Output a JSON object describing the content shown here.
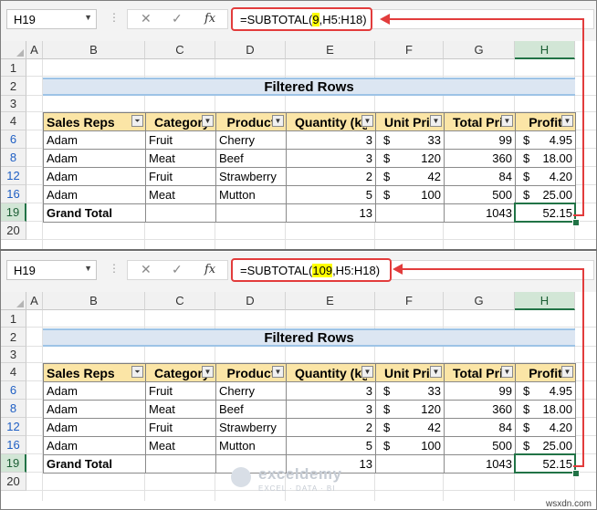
{
  "panels": [
    {
      "name_box": "H19",
      "formula_prefix": "=SUBTOTAL(",
      "formula_highlight": "9",
      "formula_suffix": ",H5:H18)"
    },
    {
      "name_box": "H19",
      "formula_prefix": "=SUBTOTAL(",
      "formula_highlight": "109",
      "formula_suffix": ",H5:H18)"
    }
  ],
  "formula_buttons": {
    "cancel": "✕",
    "enter": "✓",
    "fx": "fx",
    "dots": "⋮"
  },
  "columns": [
    "A",
    "B",
    "C",
    "D",
    "E",
    "F",
    "G",
    "H"
  ],
  "selected_column": "H",
  "rows": [
    "1",
    "2",
    "3",
    "4",
    "6",
    "8",
    "12",
    "16",
    "19",
    "20"
  ],
  "filtered_rows": [
    "6",
    "8",
    "12",
    "16"
  ],
  "selected_row": "19",
  "title": "Filtered Rows",
  "headers": [
    "Sales Reps",
    "Category",
    "Product",
    "Quantity (kg)",
    "Unit Price",
    "Total Price",
    "Profit"
  ],
  "data_rows": [
    {
      "rep": "Adam",
      "category": "Fruit",
      "product": "Cherry",
      "qty": "3",
      "unit": "33",
      "total": "99",
      "profit": "4.95"
    },
    {
      "rep": "Adam",
      "category": "Meat",
      "product": "Beef",
      "qty": "3",
      "unit": "120",
      "total": "360",
      "profit": "18.00"
    },
    {
      "rep": "Adam",
      "category": "Fruit",
      "product": "Strawberry",
      "qty": "2",
      "unit": "42",
      "total": "84",
      "profit": "4.20"
    },
    {
      "rep": "Adam",
      "category": "Meat",
      "product": "Mutton",
      "qty": "5",
      "unit": "100",
      "total": "500",
      "profit": "25.00"
    }
  ],
  "currency": "$",
  "grand_total": {
    "label": "Grand Total",
    "qty": "13",
    "total": "1043",
    "profit": "52.15"
  },
  "filter_icon": "▼",
  "active_filter_icon": "⏷",
  "accent_color": "#217346",
  "annotation_color": "#e23c3c",
  "watermark": {
    "name": "exceldemy",
    "tagline": "EXCEL · DATA · BI"
  },
  "site": "wsxdn.com"
}
